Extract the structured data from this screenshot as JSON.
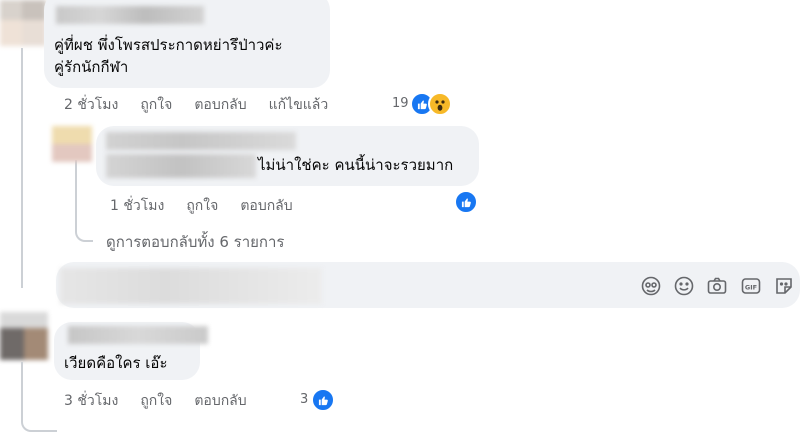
{
  "comments": [
    {
      "text_line1": "คู่ที่ผช พึ่งโพรสประกาดหย่ารึป่าวค่ะ",
      "text_line2": "คู่รักนักกีฬา",
      "time": "2 ชั่วโมง",
      "like": "ถูกใจ",
      "reply": "ตอบกลับ",
      "edited": "แก้ไขแล้ว",
      "reaction_count": "19",
      "reaction_icons": [
        "like-icon",
        "wow-icon"
      ]
    },
    {
      "text": "ไม่น่าใช่คะ คนนี้น่าจะรวยมาก",
      "time": "1 ชั่วโมง",
      "like": "ถูกใจ",
      "reply": "ตอบกลับ",
      "reaction_icons": [
        "like-icon"
      ]
    },
    {
      "text": "เวียดคือใคร เอ๊ะ",
      "time": "3 ชั่วโมง",
      "like": "ถูกใจ",
      "reply": "ตอบกลับ",
      "reaction_count": "3",
      "reaction_icons": [
        "like-icon"
      ]
    }
  ],
  "view_replies": "ดูการตอบกลับทั้ง 6 รายการ",
  "composer_tools": [
    "avatar-sticker-icon",
    "emoji-icon",
    "camera-icon",
    "gif-icon",
    "sticker-icon"
  ],
  "colors": {
    "bubble": "#f0f2f5",
    "meta": "#65676b",
    "like": "#1877f2",
    "wow": "#f7b928"
  }
}
